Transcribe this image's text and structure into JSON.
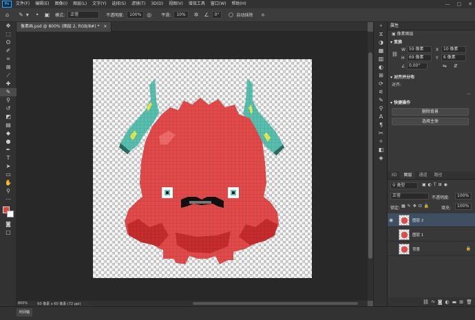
{
  "menubar": {
    "logo": "Ps",
    "items": [
      "文件(F)",
      "编辑(E)",
      "图像(I)",
      "图层(L)",
      "文字(Y)",
      "选择(S)",
      "滤镜(T)",
      "3D(D)",
      "视图(V)",
      "增效工具",
      "窗口(W)",
      "帮助(H)"
    ],
    "window_controls": [
      "—",
      "▢",
      "✕"
    ]
  },
  "options": {
    "mode_label": "模式:",
    "mode_value": "正常",
    "opacity_label": "不透明度:",
    "opacity_value": "100%",
    "smooth_label": "平滑:",
    "smooth_value": "10%",
    "angle_value": "0°",
    "auto_erase_label": "自动抹除"
  },
  "document": {
    "tab_title": "像素画.psd @ 800% (图层 2, RGB/8#) *",
    "tab_close": "×"
  },
  "status": {
    "zoom": "800%",
    "size": "60 像素 x 60 像素 (72 ppi)"
  },
  "timeline": {
    "label": "时间轴"
  },
  "properties": {
    "title": "属性",
    "subtitle": "像素图层",
    "transform_section": "变换",
    "w_label": "W",
    "w_value": "59 像素",
    "x_label": "X",
    "x_value": "10 像素",
    "h_label": "H",
    "h_value": "69 像素",
    "y_label": "Y",
    "y_value": "6 像素",
    "angle_value": "0.00°",
    "align_section": "对齐并分布",
    "align_label": "对齐:",
    "quick_section": "快捷操作",
    "remove_bg": "删除背景",
    "select_subject": "选择主体"
  },
  "layers_panel": {
    "tabs": [
      "3D",
      "图层",
      "通道",
      "路径"
    ],
    "active_tab": "图层",
    "kind_filter": "类型",
    "blend_mode": "正常",
    "opacity_label": "不透明度:",
    "opacity_value": "100%",
    "lock_label": "锁定:",
    "fill_label": "填充:",
    "fill_value": "100%",
    "layers": [
      {
        "name": "图层 2",
        "visible": true,
        "selected": true
      },
      {
        "name": "图层 1",
        "visible": false,
        "selected": false
      },
      {
        "name": "背景",
        "visible": false,
        "selected": false,
        "locked": true
      }
    ],
    "bottom_icons": [
      "link-icon",
      "fx-icon",
      "mask-icon",
      "adjustment-icon",
      "group-icon",
      "new-layer-icon",
      "delete-icon"
    ]
  },
  "colors": {
    "foreground": "#e2433f",
    "background": "#ffffff",
    "monster_body": "#e24a4a",
    "monster_shadow": "#c62c2c",
    "horn": "#56bfae",
    "horn_highlight": "#e6e84a",
    "eye": "#6ad0c8"
  }
}
